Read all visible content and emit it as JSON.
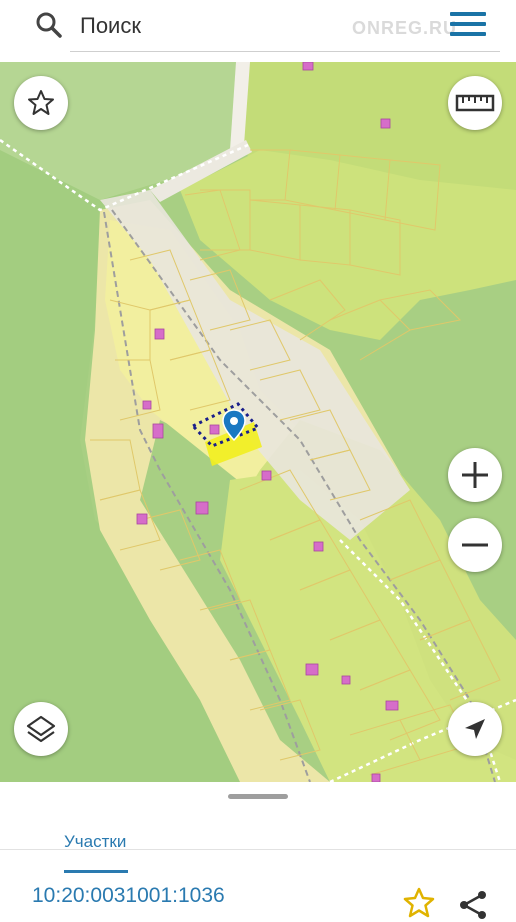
{
  "search": {
    "placeholder": "Поиск"
  },
  "brand": "ONREG.RU",
  "bottom_sheet": {
    "tab_label": "Участки",
    "parcel_id": "10:20:0031001:1036"
  },
  "colors": {
    "accent": "#2a7ab0",
    "forest": "#a6cf80",
    "parcel_fill": "#f3f29a",
    "selected_parcel": "#f2ee1e",
    "building": "#d66dc9",
    "marker": "#1a78c2"
  },
  "icons": [
    "search-icon",
    "menu-icon",
    "star-icon",
    "ruler-icon",
    "zoom-in-icon",
    "zoom-out-icon",
    "layers-icon",
    "locate-icon",
    "favorite-star-icon",
    "share-icon"
  ]
}
